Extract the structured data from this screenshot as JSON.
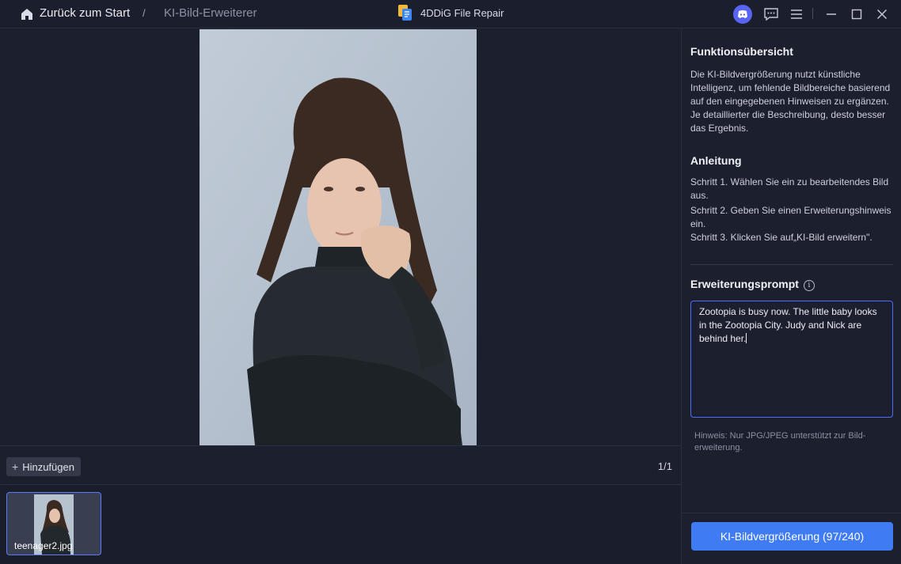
{
  "titlebar": {
    "back_label": "Zurück zum Start",
    "separator": "/",
    "current_page": "KI-Bild-Erweiterer",
    "app_title": "4DDiG File Repair"
  },
  "toolbar": {
    "add_label": "Hinzufügen",
    "page_counter": "1/1"
  },
  "thumbnails": [
    {
      "filename": "teenager2.jpg",
      "selected": true
    }
  ],
  "panel": {
    "overview_title": "Funktionsübersicht",
    "overview_text": "Die KI-Bildvergrößerung nutzt künstliche Intelligenz, um fehlende Bildbereiche basierend auf den eingegebenen Hinweisen zu ergänzen. Je detaillierter die Beschreibung, desto besser das Ergebnis.",
    "guide_title": "Anleitung",
    "steps": [
      "Schritt 1. Wählen Sie ein zu bearbeitendes Bild aus.",
      "Schritt 2. Geben Sie einen Erweiterungshinweis ein.",
      "Schritt 3. Klicken Sie auf„KI-Bild erweitern\"."
    ],
    "prompt_title": "Erweiterungsprompt",
    "prompt_value": "Zootopia is busy now. The little baby looks in the Zootopia City. Judy and Nick are behind her.",
    "hint": "Hinweis: Nur JPG/JPEG unterstützt zur Bild-erweiterung.",
    "action_button": "KI-Bildvergrößerung (97/240)"
  },
  "colors": {
    "accent": "#3f7bf2",
    "background": "#1c1f2e",
    "discord": "#5865f2"
  },
  "icons": [
    "home-icon",
    "app-logo-icon",
    "discord-icon",
    "feedback-icon",
    "menu-icon",
    "minimize-icon",
    "maximize-icon",
    "close-icon",
    "plus-icon",
    "info-icon"
  ]
}
